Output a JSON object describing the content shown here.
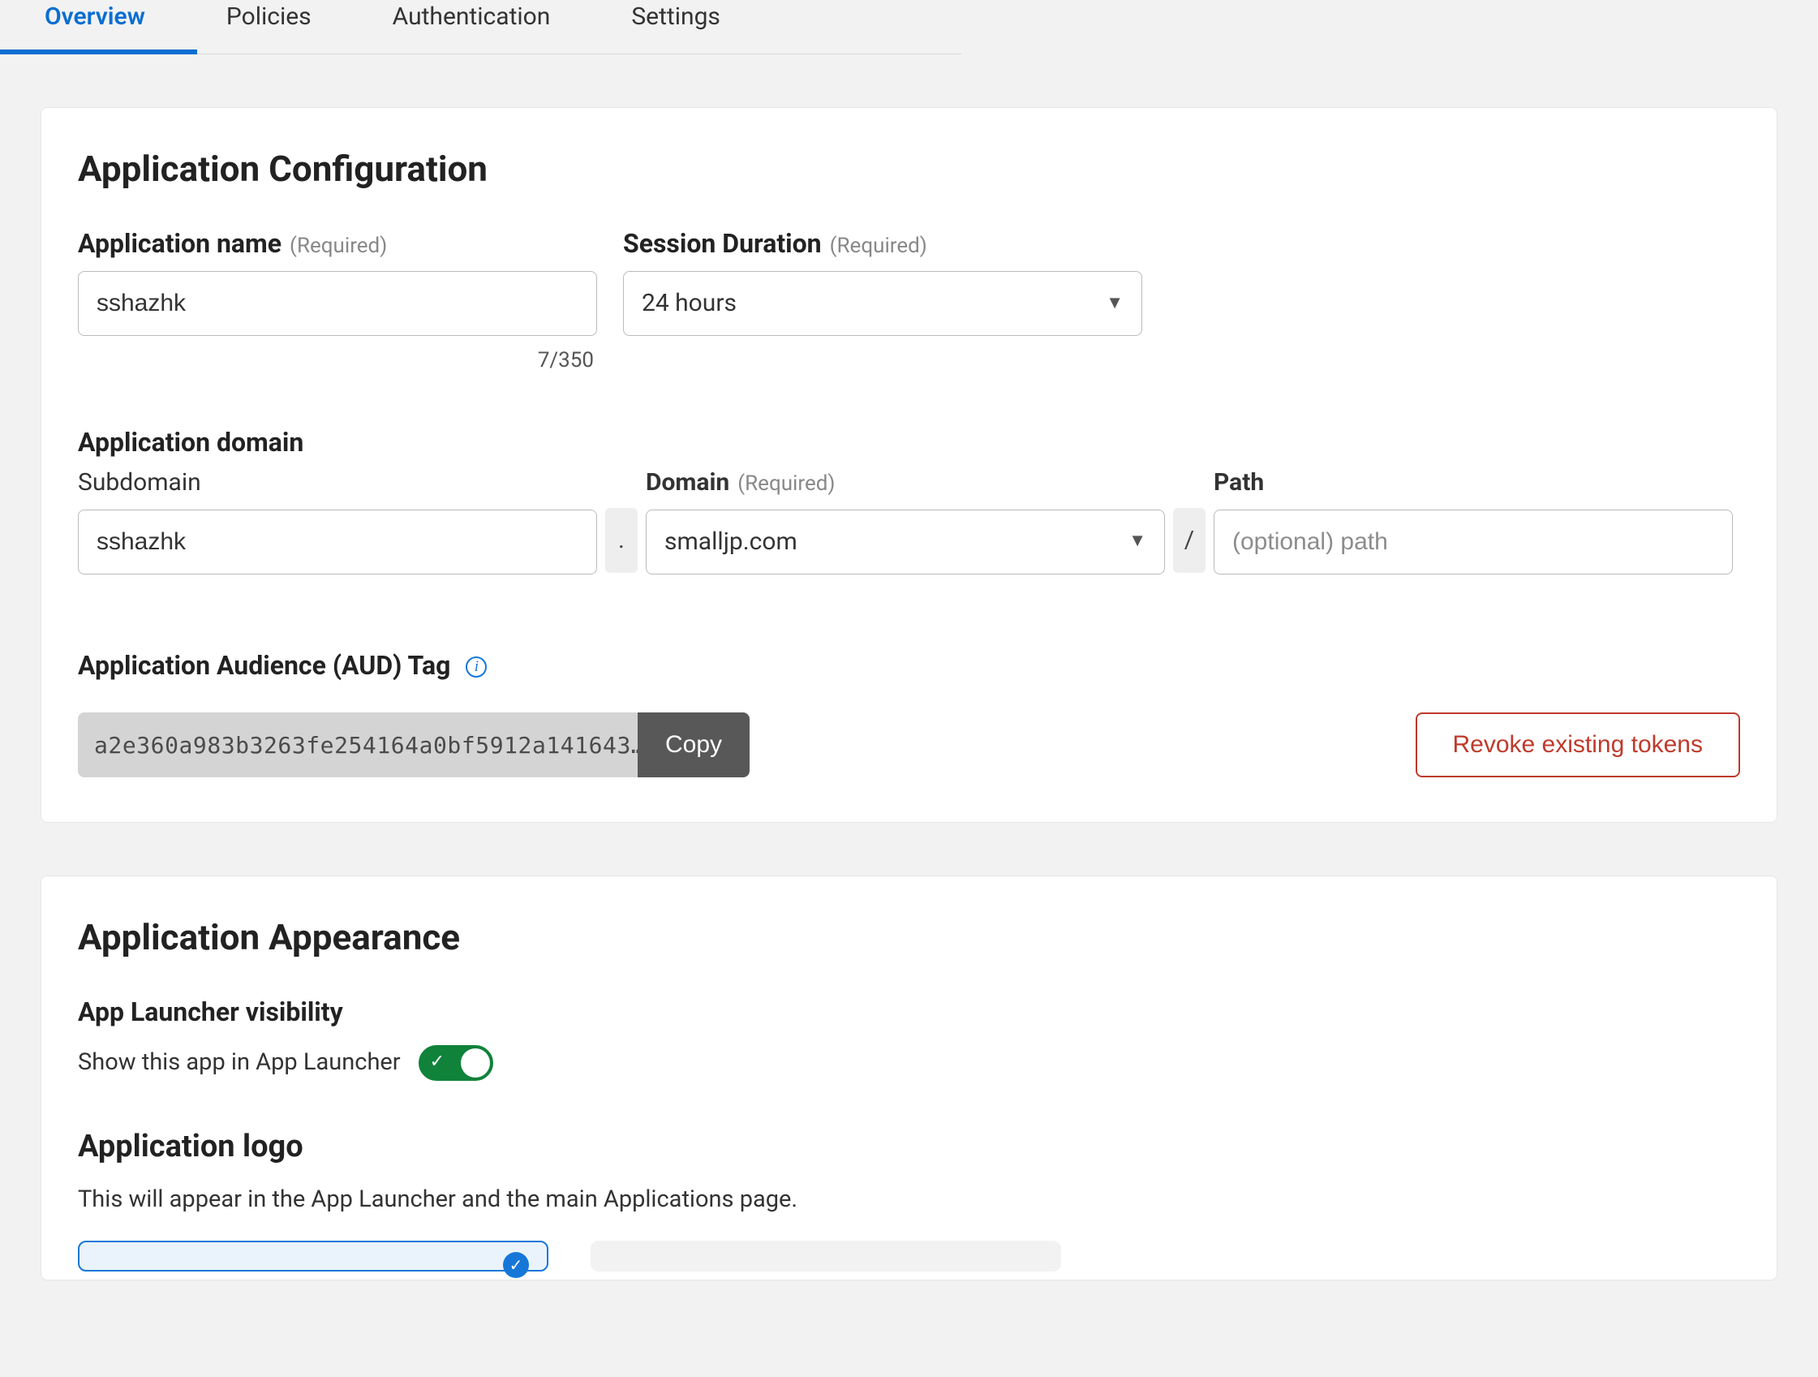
{
  "tabs": {
    "overview": "Overview",
    "policies": "Policies",
    "authentication": "Authentication",
    "settings": "Settings"
  },
  "config": {
    "heading": "Application Configuration",
    "app_name_label": "Application name",
    "app_name_required": "(Required)",
    "app_name_value": "sshazhk",
    "app_name_count": "7/350",
    "session_label": "Session Duration",
    "session_required": "(Required)",
    "session_value": "24 hours",
    "domain_section_label": "Application domain",
    "subdomain_label": "Subdomain",
    "subdomain_value": "sshazhk",
    "sep_dot": ".",
    "domain_label": "Domain",
    "domain_required": "(Required)",
    "domain_value": "smalljp.com",
    "sep_slash": "/",
    "path_label": "Path",
    "path_placeholder": "(optional) path",
    "aud_label": "Application Audience (AUD) Tag",
    "aud_value": "a2e360a983b3263fe254164a0bf5912a141643…",
    "copy_label": "Copy",
    "revoke_label": "Revoke existing tokens"
  },
  "appearance": {
    "heading": "Application Appearance",
    "launcher_label": "App Launcher visibility",
    "launcher_toggle_label": "Show this app in App Launcher",
    "logo_heading": "Application logo",
    "logo_desc": "This will appear in the App Launcher and the main Applications page."
  }
}
